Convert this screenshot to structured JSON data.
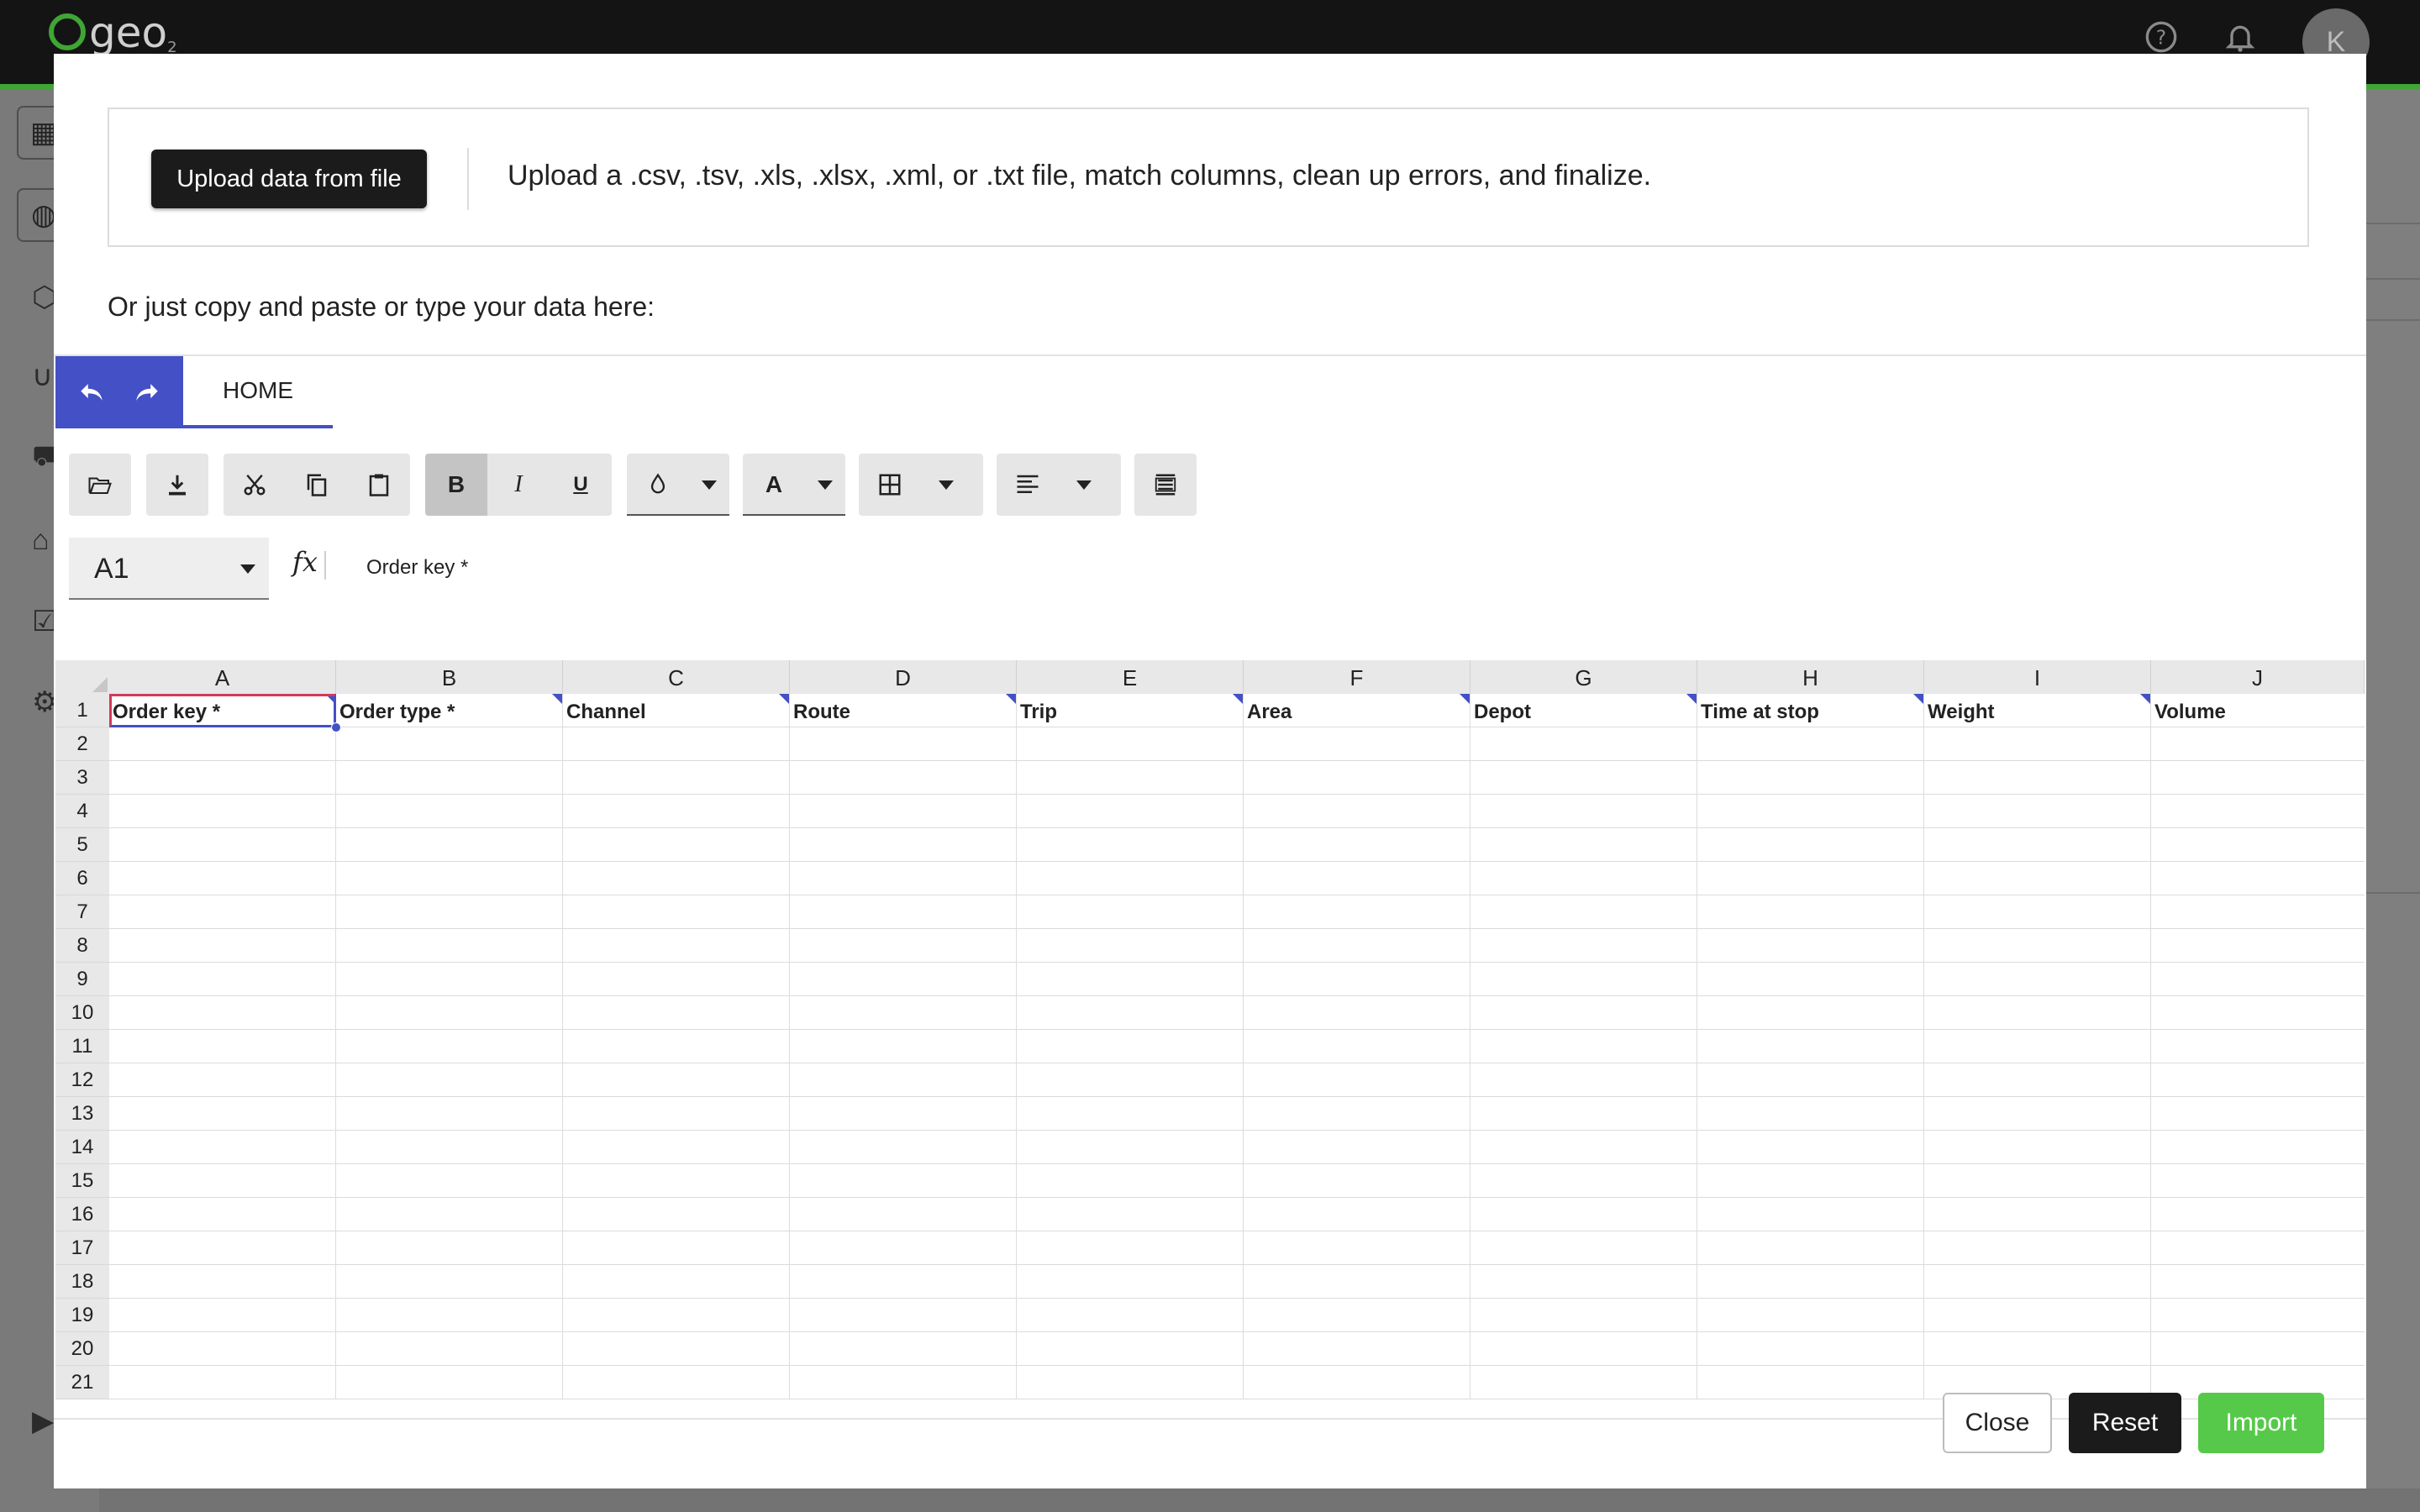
{
  "app": {
    "logo_text": "geo",
    "logo_sub": "2",
    "avatar_initial": "K"
  },
  "modal": {
    "upload_button": "Upload data from file",
    "upload_hint": "Upload a .csv, .tsv, .xls, .xlsx, .xml, or .txt file, match columns, clean up errors, and finalize.",
    "paste_hint": "Or just copy and paste or type your data here:"
  },
  "ribbon": {
    "tab": "HOME",
    "bold": "B",
    "italic": "I",
    "underline": "U",
    "font_color": "A"
  },
  "formula_bar": {
    "cell_ref": "A1",
    "fx": "fx",
    "value": "Order key *"
  },
  "sheet": {
    "columns": [
      "A",
      "B",
      "C",
      "D",
      "E",
      "F",
      "G",
      "H",
      "I",
      "J"
    ],
    "rows": [
      "1",
      "2",
      "3",
      "4",
      "5",
      "6",
      "7",
      "8",
      "9",
      "10",
      "11",
      "12",
      "13",
      "14",
      "15",
      "16",
      "17",
      "18",
      "19",
      "20",
      "21"
    ],
    "headers": [
      "Order key *",
      "Order type *",
      "Channel",
      "Route",
      "Trip",
      "Area",
      "Depot",
      "Time at stop",
      "Weight",
      "Volume"
    ]
  },
  "footer": {
    "close": "Close",
    "reset": "Reset",
    "import": "Import"
  },
  "colors": {
    "accent": "#4450c6",
    "brand_green": "#3fa535",
    "import_green": "#57c94a"
  }
}
